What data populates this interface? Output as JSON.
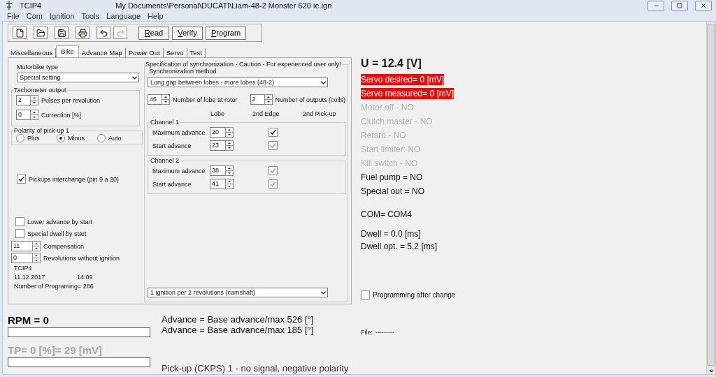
{
  "window": {
    "title": "TCIP4",
    "path": "My Documents\\Personal\\DUCATI\\Liam-48-2 Monster 620 ie.ign"
  },
  "menu": [
    "File",
    "Com",
    "Ignition",
    "Tools",
    "Language",
    "Help"
  ],
  "toolbar": {
    "icons": [
      {
        "kind": "new",
        "disabled": false
      },
      {
        "kind": "open",
        "disabled": false
      },
      {
        "kind": "save",
        "disabled": false
      },
      {
        "kind": "print",
        "disabled": false
      },
      {
        "kind": "undo",
        "disabled": false
      },
      {
        "kind": "redo",
        "disabled": true
      }
    ],
    "buttons": [
      {
        "label": "Read",
        "kind": "small"
      },
      {
        "label": "Verify",
        "kind": "small"
      },
      {
        "label": "Program",
        "kind": "wide"
      }
    ]
  },
  "tabs": [
    {
      "label": "Miscellaneous",
      "selected": false
    },
    {
      "label": "Bike",
      "selected": true
    },
    {
      "label": "Advance Map",
      "selected": false
    },
    {
      "label": "Power Out",
      "selected": false
    },
    {
      "label": "Servo",
      "selected": false
    },
    {
      "label": "Test",
      "selected": false
    }
  ],
  "bike": {
    "motorbike_type": {
      "label": "Motorbike type",
      "value": "Special setting"
    },
    "tachometer": {
      "title": "Tachometer output",
      "fields": [
        {
          "value": "2",
          "label": "Pulses per revolution"
        },
        {
          "value": "0",
          "label": "Correction [%]"
        }
      ]
    },
    "polarity": {
      "title": "Polarity of pick-up 1",
      "options": [
        {
          "label": "Plus",
          "selected": false
        },
        {
          "label": "Minus",
          "selected": true
        },
        {
          "label": "Auto",
          "selected": false
        }
      ]
    },
    "pickups_interchange": {
      "label": "Pickups interchange (pin 9 a 20)",
      "checked": true
    },
    "start_options": [
      {
        "label": "Lower advance by start",
        "checked": false
      },
      {
        "label": "Special dwell by start",
        "checked": false
      }
    ],
    "spinners": [
      {
        "value": "11",
        "label": "Compensation"
      },
      {
        "value": "0",
        "label": "Revolutions without ignition"
      }
    ],
    "device": "TCIP4",
    "date": "11.12.2017",
    "time": "14:09",
    "programming_count": "Number of Programing= 286"
  },
  "sync": {
    "title": "Specification of synchronization - Caution - For experienced user only!",
    "method_label": "Synchronization method",
    "method_value": "Long gap between lobes - more lobes (48-2)",
    "lobes": {
      "value": "46",
      "label": "Number of lobe at rotor"
    },
    "outputs": {
      "value": "2",
      "label": "Number of outputs (coils)"
    },
    "columns": [
      "Lobe",
      "2nd Edge",
      "2nd Pick-up"
    ],
    "channels": [
      {
        "title": "Channel 1",
        "rows": [
          {
            "label": "Maximum advance",
            "value": "20",
            "checked": true,
            "disabled": false
          },
          {
            "label": "Start advance",
            "value": "23",
            "checked": true,
            "disabled": true
          }
        ]
      },
      {
        "title": "Channel 2",
        "rows": [
          {
            "label": "Maximum advance",
            "value": "38",
            "checked": true,
            "disabled": true
          },
          {
            "label": "Start advance",
            "value": "41",
            "checked": true,
            "disabled": true
          }
        ]
      }
    ],
    "ignition_mode": "1 ignition per 2 revolutions (camshaft)"
  },
  "status": {
    "voltage": "U = 12.4 [V]",
    "items": [
      {
        "text": "Servo desired= 0 [mV]",
        "kind": "alert"
      },
      {
        "text": "Servo measured= 0 [mV]",
        "kind": "alert"
      },
      {
        "text": "Motor off - NO",
        "kind": "inactive"
      },
      {
        "text": "Clutch master - NO",
        "kind": "inactive"
      },
      {
        "text": "Retard - NO",
        "kind": "inactive"
      },
      {
        "text": "Start limiter: NO",
        "kind": "inactive"
      },
      {
        "text": "Kill switch - NO",
        "kind": "inactive"
      },
      {
        "text": "Fuel pump = NO",
        "kind": "normal"
      },
      {
        "text": "Special out = NO",
        "kind": "normal"
      }
    ],
    "com": "COM= COM4",
    "dwell": "Dwell = 0.0 [ms]",
    "dwell_opt": "Dwell opt. = 5.2 [ms]"
  },
  "programming_after_change": {
    "label": "Programming after change",
    "checked": false
  },
  "file": {
    "label": "File:",
    "value": "---------"
  },
  "rpm": {
    "label": "RPM = 0",
    "level": 0,
    "disabled": false
  },
  "tp": {
    "label": "TP= 0 [%]= 29 [mV]",
    "level": 0,
    "disabled": true
  },
  "advance": [
    "Advance = Base advance/max 526 [°]",
    "Advance = Base advance/max 185 [°]"
  ],
  "pickup_message": "Pick-up (CKPS) 1 - no signal, negative polarity"
}
